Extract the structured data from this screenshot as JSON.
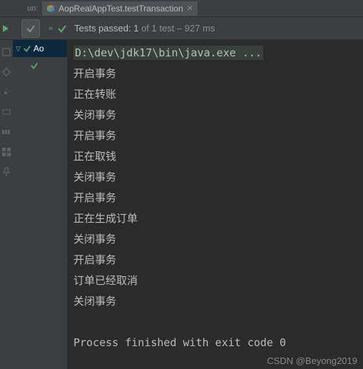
{
  "header": {
    "run_label": "un:",
    "tab_title": "AopRealAppTest.testTransaction"
  },
  "toolbar": {
    "passed_prefix": "Tests passed: 1",
    "passed_suffix": " of 1 test – 927 ms"
  },
  "tree": {
    "root_label": "Ao",
    "child_pass": true
  },
  "console": {
    "command": "D:\\dev\\jdk17\\bin\\java.exe ...",
    "lines": [
      "开启事务",
      "正在转账",
      "关闭事务",
      "开启事务",
      "正在取钱",
      "关闭事务",
      "开启事务",
      "正在生成订单",
      "关闭事务",
      "开启事务",
      "订单已经取消",
      "关闭事务",
      "",
      "Process finished with exit code 0"
    ]
  },
  "watermark": "CSDN @Beyong2019"
}
